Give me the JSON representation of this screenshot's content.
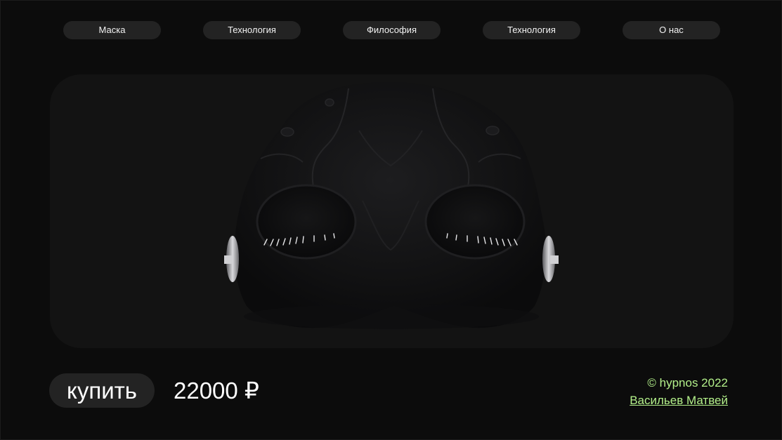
{
  "nav": {
    "items": [
      {
        "label": "Маска"
      },
      {
        "label": "Технология"
      },
      {
        "label": "Философия"
      },
      {
        "label": "Технология"
      },
      {
        "label": "О нас"
      }
    ]
  },
  "hero": {
    "image": "black-sleep-mask-3d-render"
  },
  "purchase": {
    "buy_label": "купить",
    "price": "22000 ₽"
  },
  "footer": {
    "copyright": "© hypnos 2022",
    "author": "Васильев Матвей"
  },
  "colors": {
    "background": "#0c0c0c",
    "panel": "#131313",
    "pill": "#232323",
    "accent": "#b3f08a"
  }
}
